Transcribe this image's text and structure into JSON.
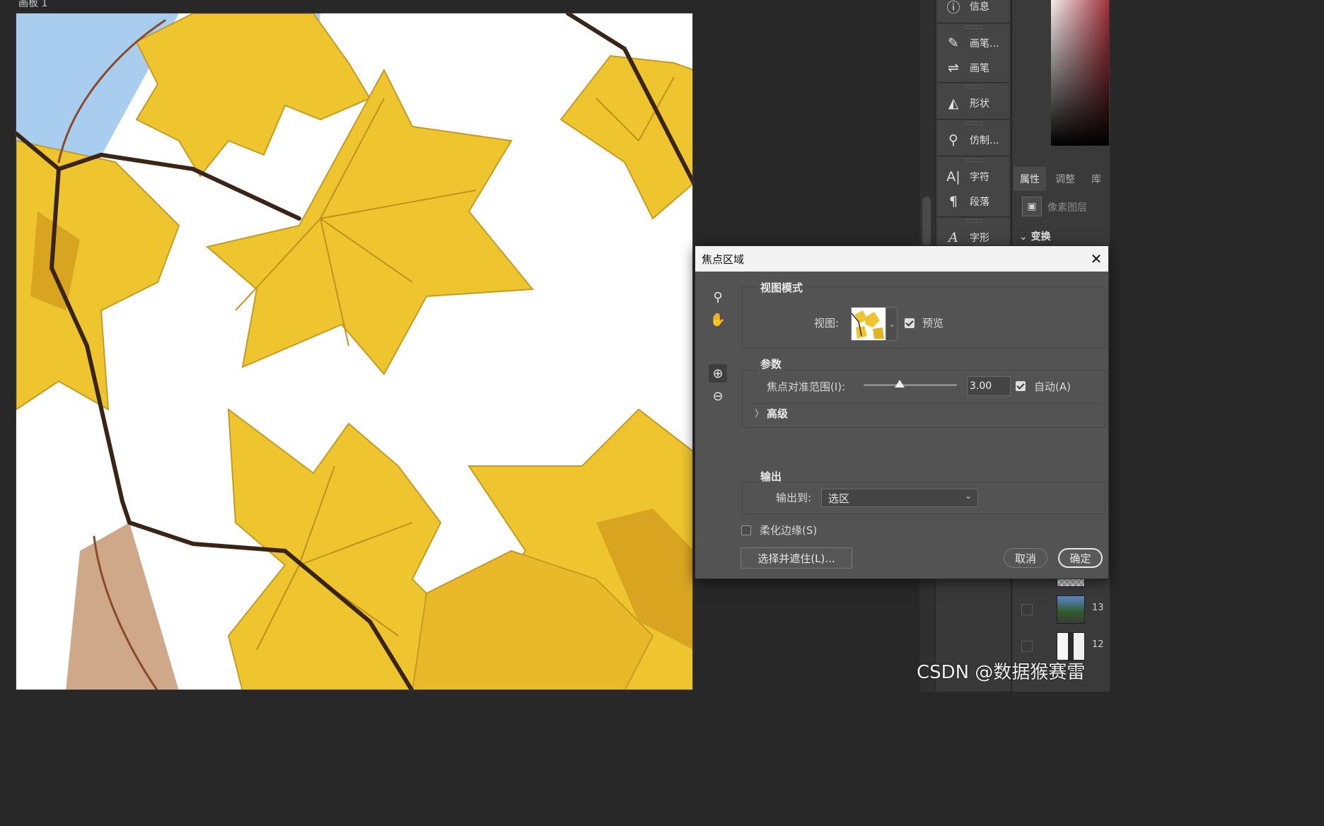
{
  "artboard": {
    "label": "画板 1"
  },
  "tools_panel": {
    "items": [
      {
        "label": "信息",
        "icon": "info-icon"
      },
      {
        "label": "画笔...",
        "icon": "brush-settings-icon"
      },
      {
        "label": "画笔",
        "icon": "brush-icon"
      },
      {
        "label": "形状",
        "icon": "shapes-icon"
      },
      {
        "label": "仿制...",
        "icon": "clone-source-icon"
      },
      {
        "label": "字符",
        "icon": "character-icon"
      },
      {
        "label": "段落",
        "icon": "paragraph-icon"
      },
      {
        "label": "字形",
        "icon": "glyphs-icon"
      }
    ]
  },
  "properties_panel": {
    "tabs": [
      "属性",
      "调整",
      "库"
    ],
    "layer_type": "像素图层",
    "section": "变换"
  },
  "layers": [
    {
      "number": "13"
    },
    {
      "number": "12"
    }
  ],
  "dialog": {
    "title": "焦点区域",
    "close_symbol": "✕",
    "view_mode": {
      "title": "视图模式",
      "view_label": "视图:",
      "preview_label": "预览",
      "preview_checked": true
    },
    "parameters": {
      "title": "参数",
      "focus_range_label": "焦点对准范围(I):",
      "focus_range_value": "3.00",
      "focus_range_fraction": 0.39,
      "auto_label": "自动(A)",
      "auto_checked": true,
      "advanced_label": "高级",
      "advanced_chevron": "〉"
    },
    "output": {
      "title": "输出",
      "output_to_label": "输出到:",
      "output_to_value": "选区"
    },
    "soften_edge_label": "柔化边缘(S)",
    "soften_edge_checked": false,
    "select_and_mask_label": "选择并遮住(L)...",
    "cancel_label": "取消",
    "ok_label": "确定"
  },
  "watermark": "CSDN @数据猴赛雷",
  "colors": {
    "leaf": "#efc52f",
    "leaf_shadow": "#d9a521",
    "sky": "#a9cdee",
    "branch": "#3a2416"
  }
}
